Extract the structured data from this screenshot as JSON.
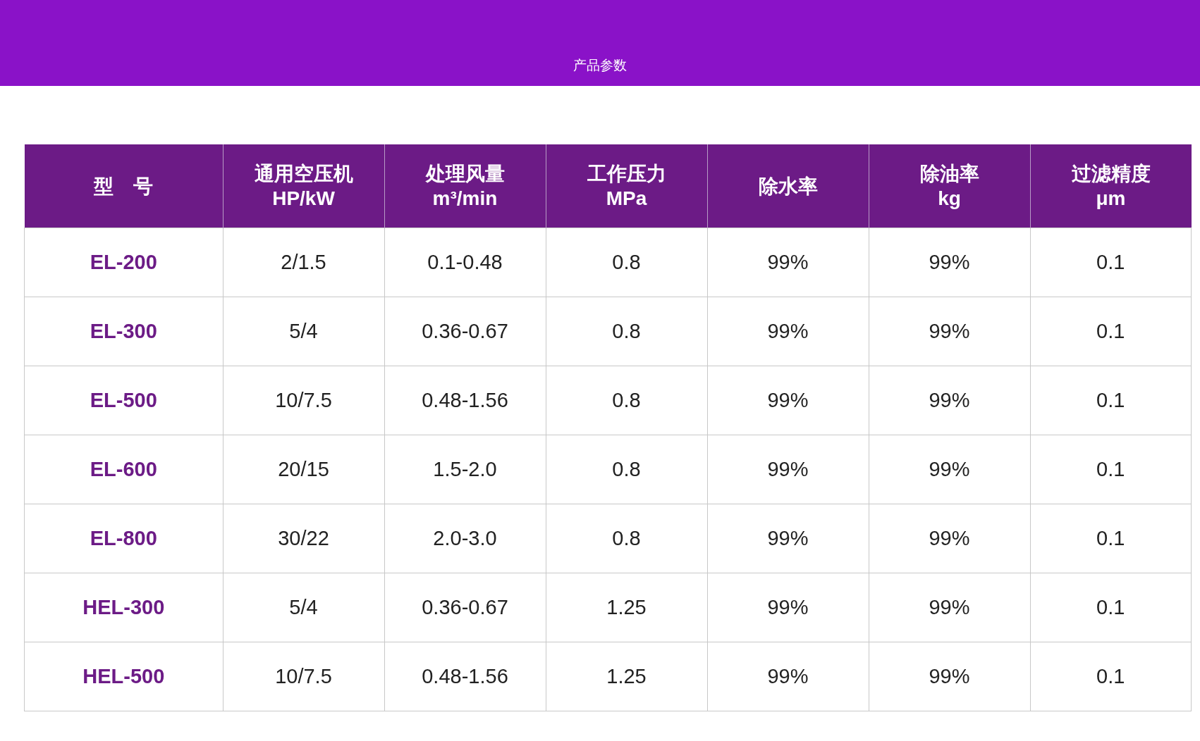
{
  "banner": {
    "title": "产品参数"
  },
  "table": {
    "columns": [
      {
        "name": "型　号"
      },
      {
        "name": "通用空压机",
        "unit": "HP/kW"
      },
      {
        "name": "处理风量",
        "unit": "m³/min"
      },
      {
        "name": "工作压力",
        "unit": "MPa"
      },
      {
        "name": "除水率"
      },
      {
        "name": "除油率",
        "unit": "kg"
      },
      {
        "name": "过滤精度",
        "unit": "μm"
      }
    ],
    "rows": [
      [
        "EL-200",
        "2/1.5",
        "0.1-0.48",
        "0.8",
        "99%",
        "99%",
        "0.1"
      ],
      [
        "EL-300",
        "5/4",
        "0.36-0.67",
        "0.8",
        "99%",
        "99%",
        "0.1"
      ],
      [
        "EL-500",
        "10/7.5",
        "0.48-1.56",
        "0.8",
        "99%",
        "99%",
        "0.1"
      ],
      [
        "EL-600",
        "20/15",
        "1.5-2.0",
        "0.8",
        "99%",
        "99%",
        "0.1"
      ],
      [
        "EL-800",
        "30/22",
        "2.0-3.0",
        "0.8",
        "99%",
        "99%",
        "0.1"
      ],
      [
        "HEL-300",
        "5/4",
        "0.36-0.67",
        "1.25",
        "99%",
        "99%",
        "0.1"
      ],
      [
        "HEL-500",
        "10/7.5",
        "0.48-1.56",
        "1.25",
        "99%",
        "99%",
        "0.1"
      ]
    ]
  }
}
